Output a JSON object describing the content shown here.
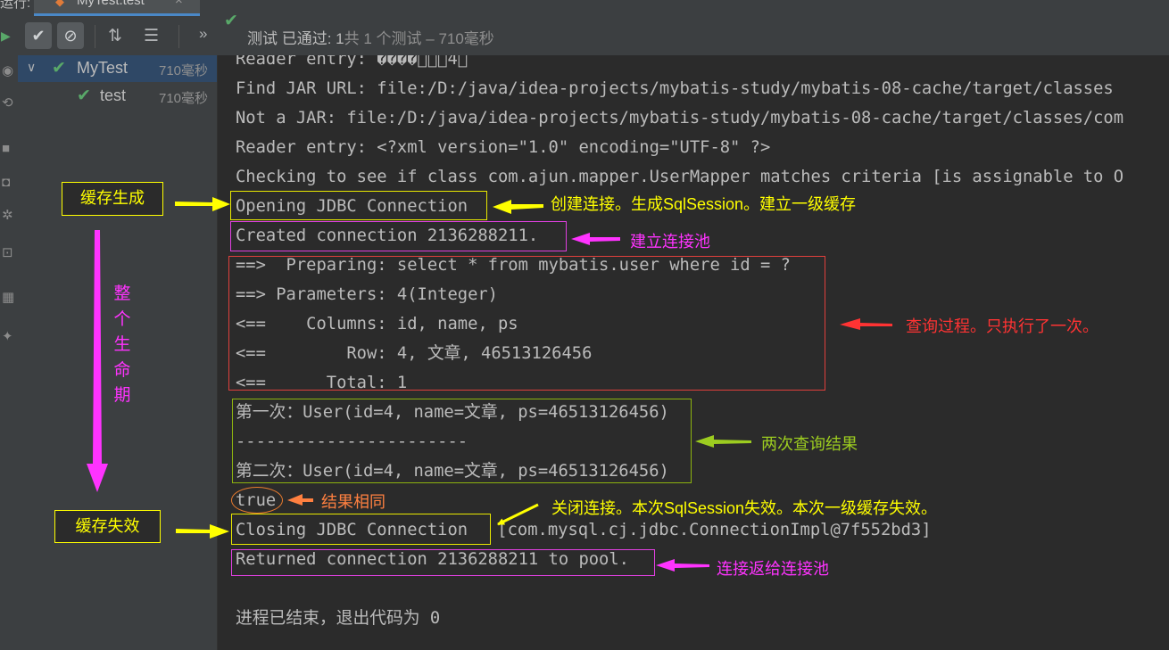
{
  "tabbar": {
    "run_label": "运行:",
    "tab_label": "MyTest.test",
    "close_glyph": "×"
  },
  "toolbar": {
    "status_prefix": "测试 已通过: ",
    "status_count": "1",
    "status_rest": "共 1 个测试 – 710毫秒",
    "expand_glyph": "»"
  },
  "tree": [
    {
      "label": "MyTest",
      "time": "710毫秒"
    },
    {
      "label": "test",
      "time": "710毫秒"
    }
  ],
  "console": {
    "lines": [
      "Reader entry: ����\u0000\u0000\u00004\u0000",
      "Find JAR URL: file:/D:/java/idea-projects/mybatis-study/mybatis-08-cache/target/classes",
      "Not a JAR: file:/D:/java/idea-projects/mybatis-study/mybatis-08-cache/target/classes/com",
      "Reader entry: <?xml version=\"1.0\" encoding=\"UTF-8\" ?>",
      "Checking to see if class com.ajun.mapper.UserMapper matches criteria [is assignable to O",
      "Opening JDBC Connection",
      "Created connection 2136288211.",
      "==>  Preparing: select * from mybatis.user where id = ?",
      "==> Parameters: 4(Integer)",
      "<==    Columns: id, name, ps",
      "<==        Row: 4, 文章, 46513126456",
      "<==      Total: 1",
      "第一次：User(id=4, name=文章, ps=46513126456)",
      "-----------------------",
      "第二次：User(id=4, name=文章, ps=46513126456)",
      "true",
      "Closing JDBC Connection",
      " [com.mysql.cj.jdbc.ConnectionImpl@7f552bd3]",
      "Returned connection 2136288211 to pool.",
      "进程已结束，退出代码为 0"
    ]
  },
  "annotations": {
    "cache_created": "缓存生成",
    "cache_invalid": "缓存失效",
    "lifecycle": [
      "整",
      "个",
      "生",
      "命",
      "期"
    ],
    "create_conn": "创建连接。生成SqlSession。建立一级缓存",
    "pool": "建立连接池",
    "query": "查询过程。只执行了一次。",
    "two_results": "两次查询结果",
    "same": "结果相同",
    "close_conn": "关闭连接。本次SqlSession失效。本次一级缓存失效。",
    "returned": "连接返给连接池"
  },
  "colors": {
    "yellow": "#ffff00",
    "magenta": "#ff33ff",
    "red": "#ff3333",
    "green": "#9ccc20",
    "orange": "#ff8040",
    "pass_green": "#59a869"
  }
}
